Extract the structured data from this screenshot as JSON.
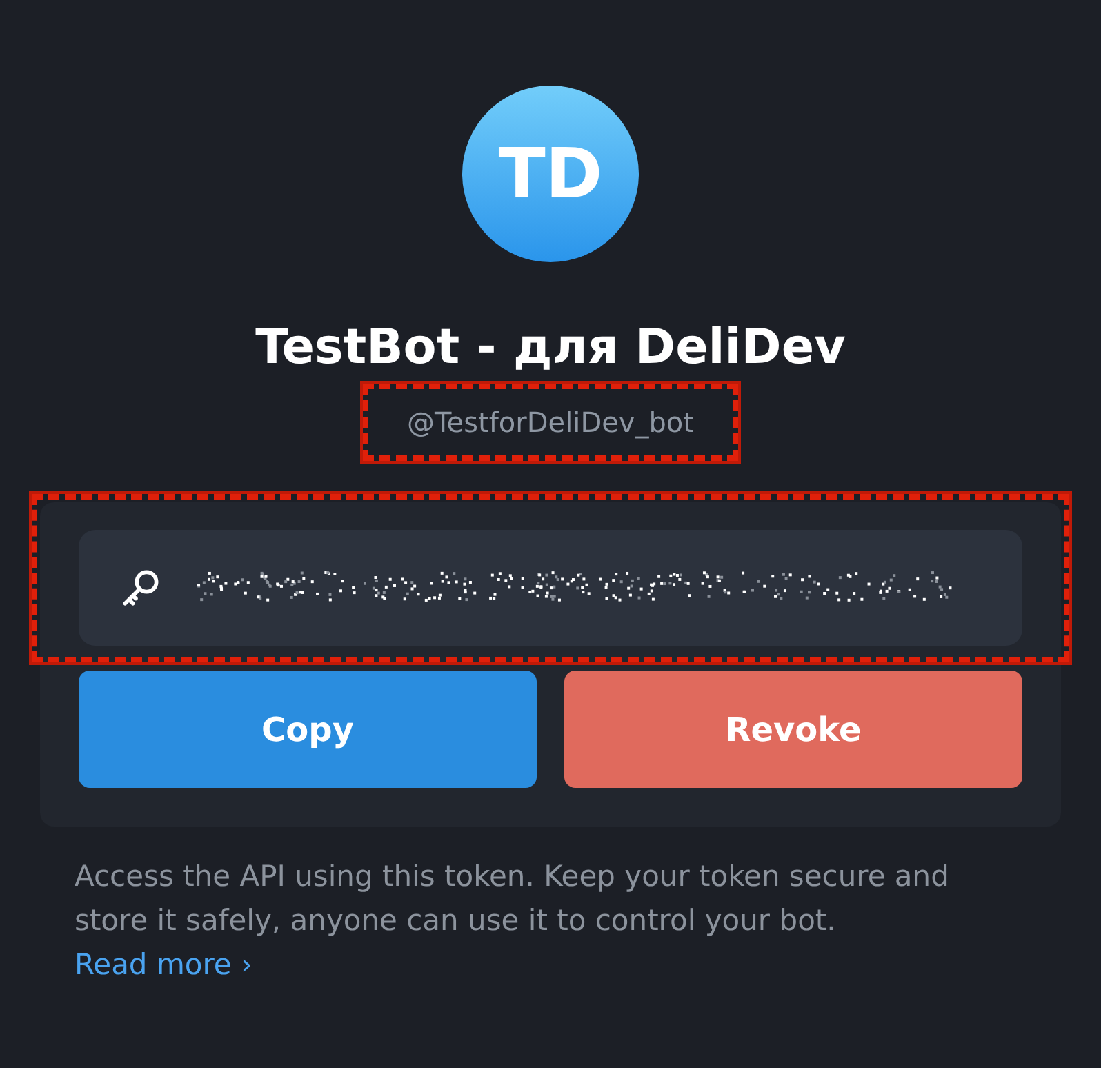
{
  "avatar": {
    "initials": "TD"
  },
  "title": "TestBot - для DeliDev",
  "username": {
    "text": "@TestforDeliDev_bot",
    "highlighted": true
  },
  "token_field": {
    "highlighted": true,
    "obscured": true
  },
  "buttons": [
    {
      "label": "Copy",
      "kind": "primary"
    },
    {
      "label": "Revoke",
      "kind": "danger"
    }
  ],
  "description": "Access the API using this token. Keep your token secure and store it safely, anyone can use it to control your bot.",
  "link": {
    "label": "Read more",
    "chevron": "›"
  }
}
